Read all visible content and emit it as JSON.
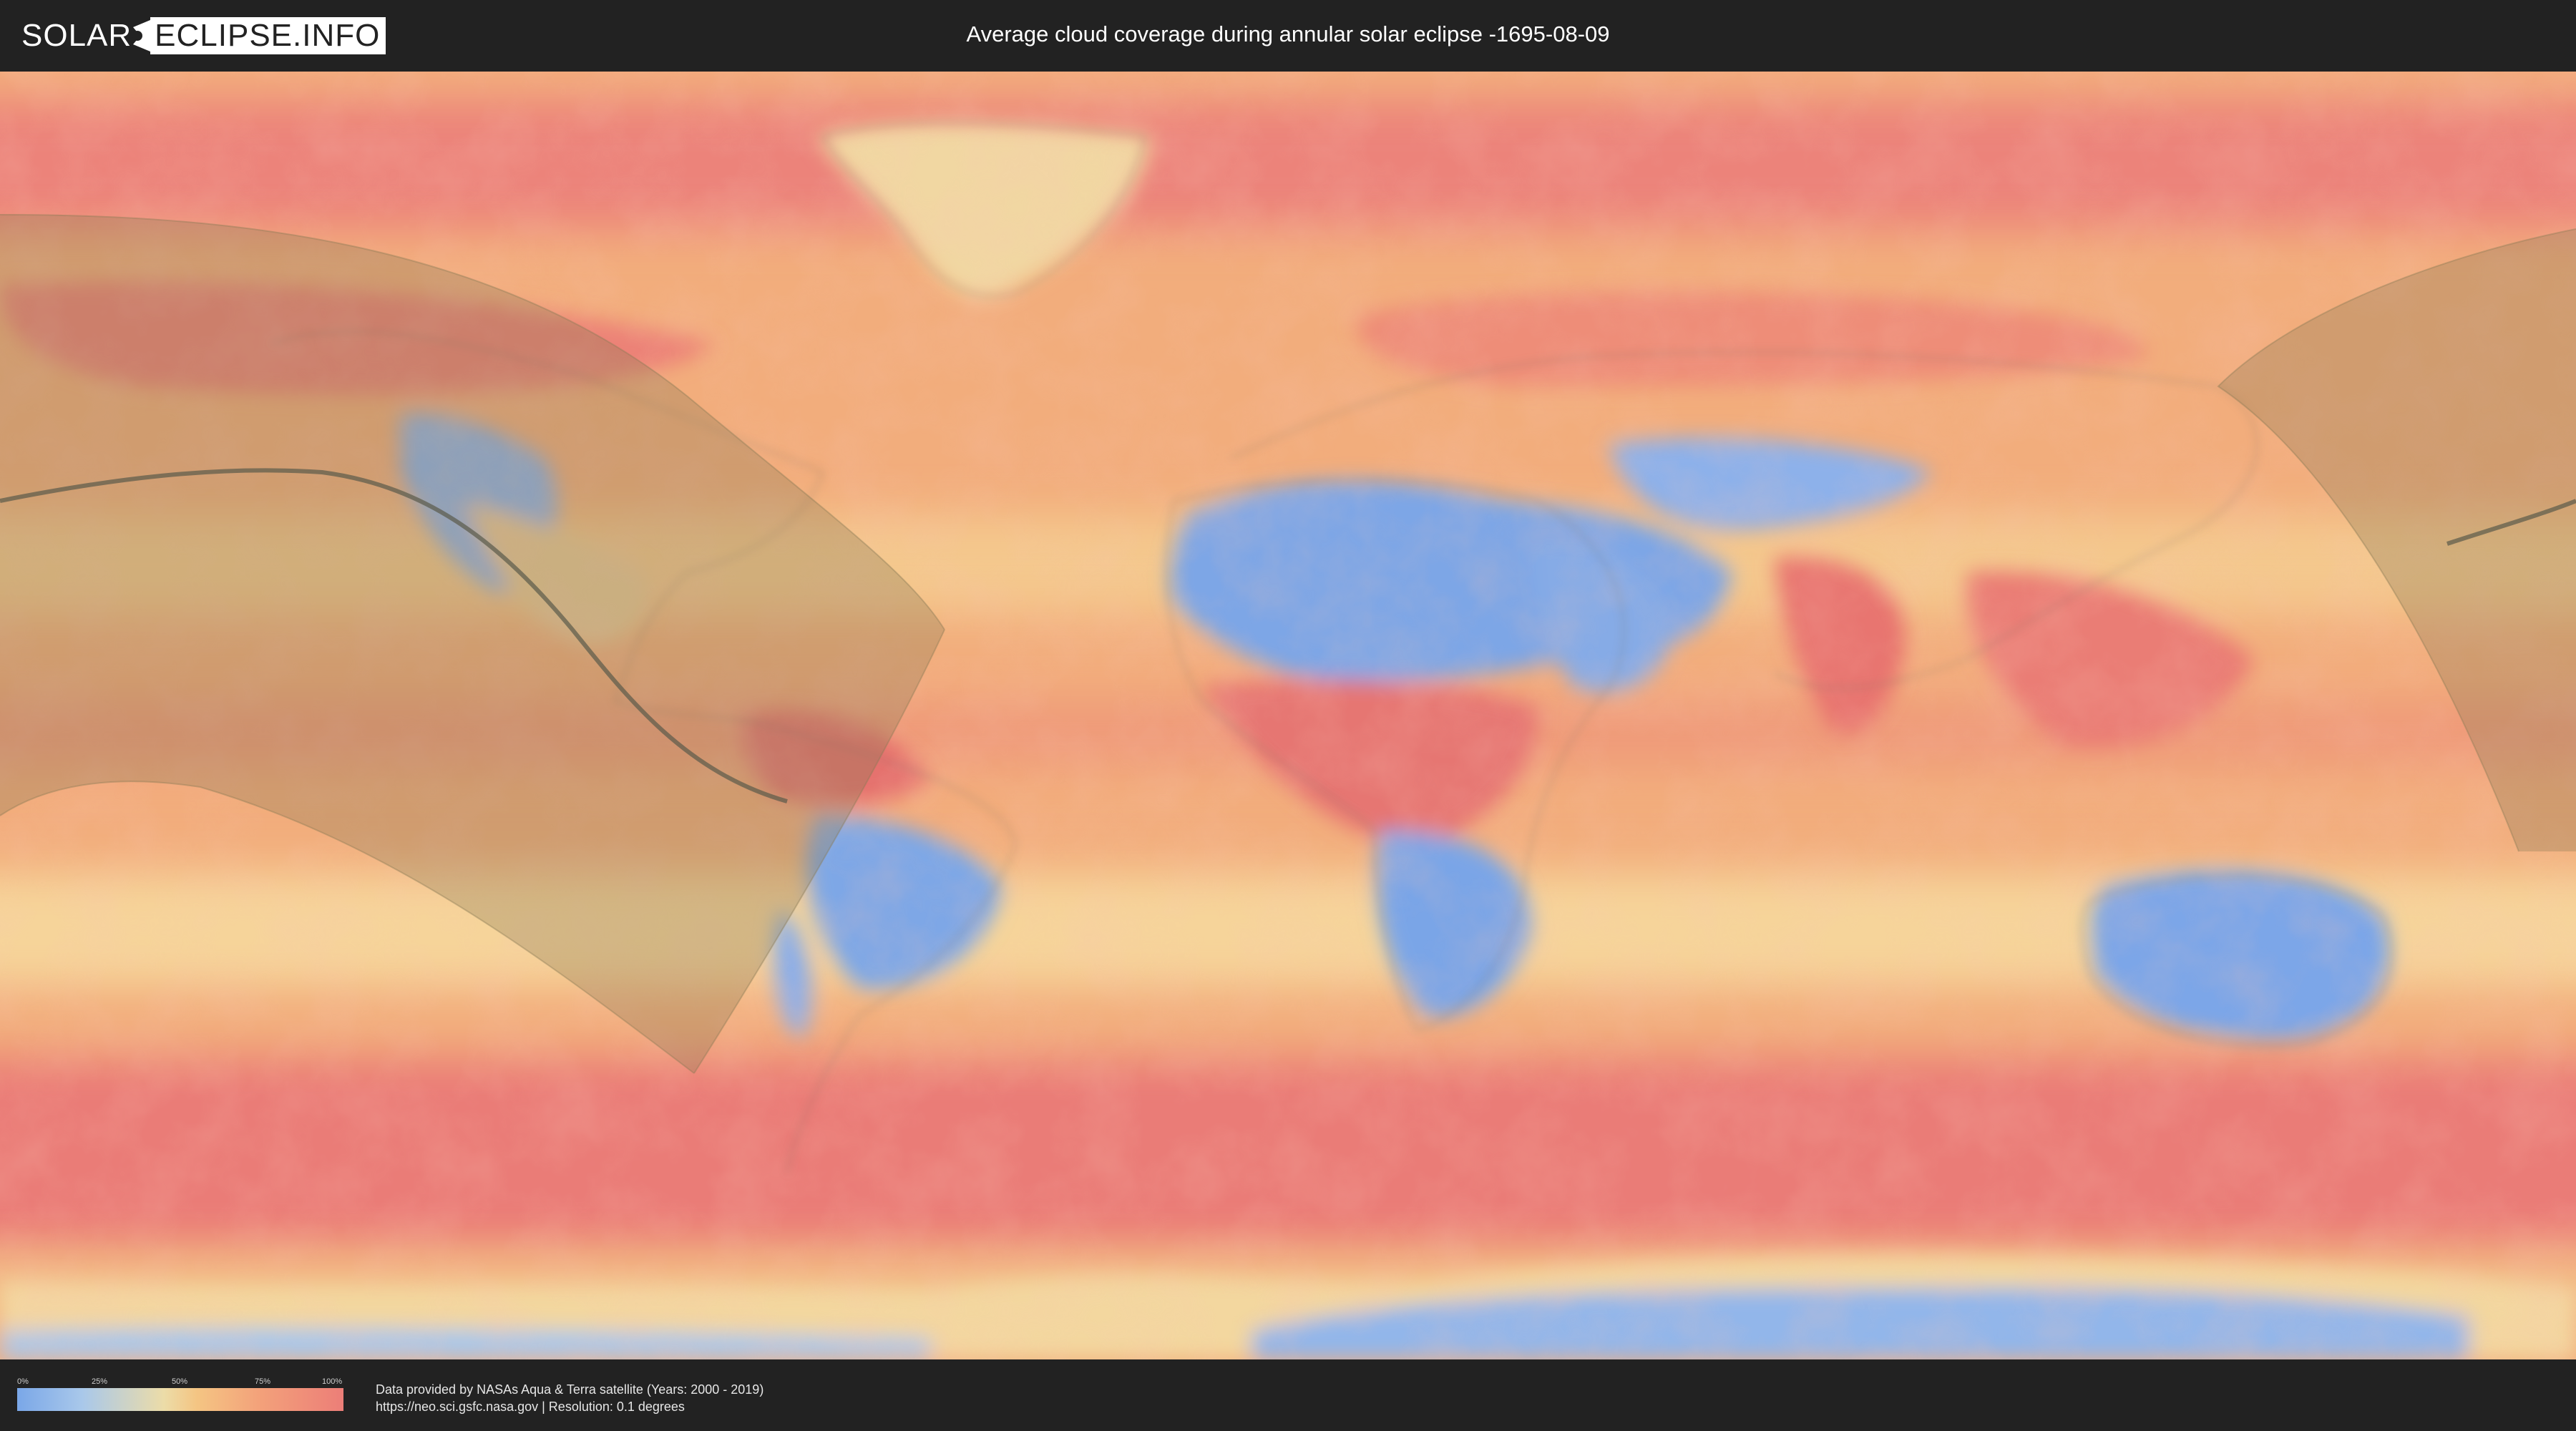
{
  "header": {
    "logo_text_left": "SOLAR",
    "logo_text_right": "ECLIPSE.INFO",
    "title": "Average cloud coverage during annular solar eclipse -1695-08-09"
  },
  "map": {
    "projection": "equirectangular",
    "colors": {
      "clear": "#7aa7e8",
      "low": "#a9c8ea",
      "medium": "#ecdca8",
      "high": "#f3a07a",
      "overcast": "#ec7e78",
      "ice": "#9fc2ec",
      "eclipse_shadow": "#8a7a55",
      "central_line": "#5a5a4a",
      "border": "#6f6a5a"
    }
  },
  "legend": {
    "ticks": [
      "0%",
      "25%",
      "50%",
      "75%",
      "100%"
    ],
    "tick_values": [
      0,
      25,
      50,
      75,
      100
    ]
  },
  "footer": {
    "credit_line1": "Data provided by NASAs Aqua & Terra satellite (Years: 2000 - 2019)",
    "credit_line2": "https://neo.sci.gsfc.nasa.gov | Resolution: 0.1 degrees"
  }
}
